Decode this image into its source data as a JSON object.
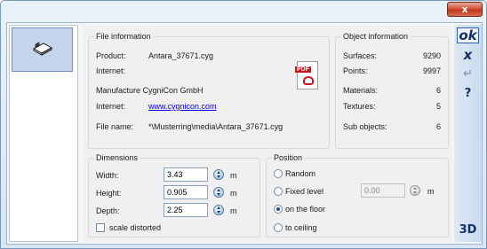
{
  "window": {
    "close_label": "x"
  },
  "file_information": {
    "title": "File information",
    "product_label": "Product:",
    "product_value": "Antara_37671.cyg",
    "internet_label_1": "Internet:",
    "manufacturer": "Manufacture CygniCon GmbH",
    "internet_label_2": "Internet:",
    "internet_link": "www.cygnicon.com",
    "filename_label": "File name:",
    "filename_value": "*\\Musterring\\media\\Antara_37671.cyg"
  },
  "object_information": {
    "title": "Object information",
    "rows": [
      {
        "label": "Surfaces:",
        "value": "9290"
      },
      {
        "label": "Points:",
        "value": "9997"
      },
      {
        "label": "Materials:",
        "value": "6"
      },
      {
        "label": "Textures:",
        "value": "5"
      },
      {
        "label": "Sub objects:",
        "value": "6"
      }
    ]
  },
  "dimensions": {
    "title": "Dimensions",
    "width_label": "Width:",
    "width_value": "3.43",
    "height_label": "Height:",
    "height_value": "0.905",
    "depth_label": "Depth:",
    "depth_value": "2.25",
    "unit": "m",
    "scale_label": "scale distorted"
  },
  "position": {
    "title": "Position",
    "random_label": "Random",
    "fixed_label": "Fixed level",
    "fixed_value": "0.00",
    "fixed_unit": "m",
    "floor_label": "on the floor",
    "ceiling_label": "to ceiling",
    "selected": "on the floor"
  },
  "toolbar": {
    "ok_label": "ok",
    "cancel_label": "x",
    "apply_label": "↵",
    "help_label": "?",
    "view3d_label": "3D"
  },
  "colors": {
    "accent": "#13316a",
    "link": "#0000ee",
    "close": "#c1391c"
  }
}
